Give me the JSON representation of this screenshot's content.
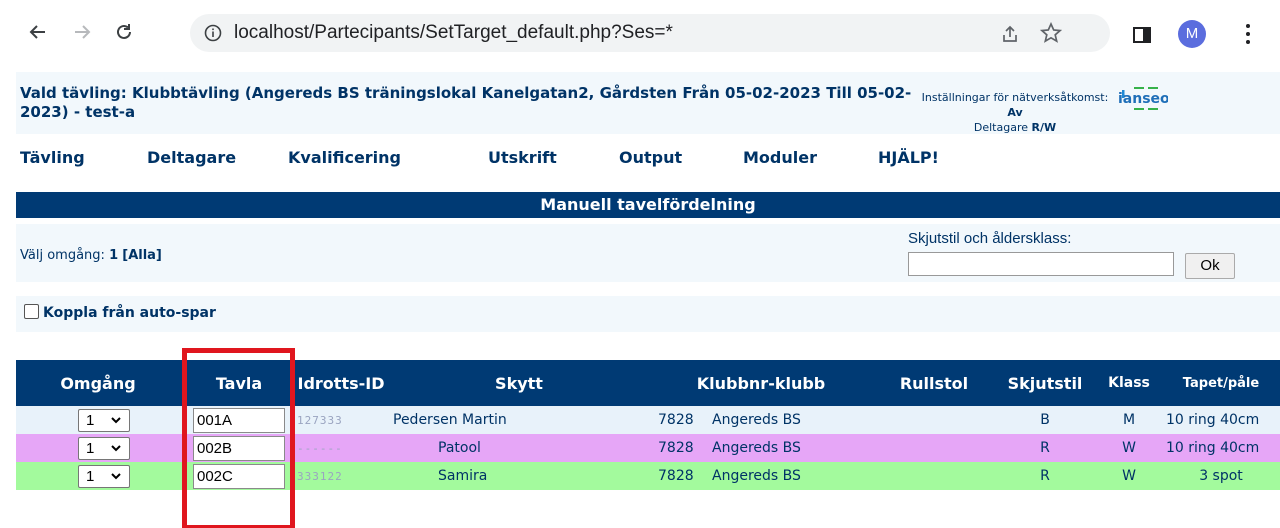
{
  "browser": {
    "url": "localhost/Partecipants/SetTarget_default.php?Ses=*",
    "profile_initial": "M"
  },
  "header": {
    "competition_title": "Vald tävling: Klubbtävling (Angereds BS träningslokal Kanelgatan2, Gårdsten Från 05-02-2023 Till 05-02-2023) - test-a",
    "network_label": "Inställningar för nätverksåtkomst:",
    "network_value": "Av",
    "participants_label": "Deltagare",
    "participants_value": "R/W",
    "logo_text": "ianseo"
  },
  "menu": {
    "items": [
      "Tävling",
      "Deltagare",
      "Kvalificering",
      "Utskrift",
      "Output",
      "Moduler",
      "HJÄLP!"
    ]
  },
  "section_title": "Manuell tavelfördelning",
  "filters": {
    "round_label": "Välj omgång:",
    "round_current": "1",
    "round_all": "[Alla]",
    "style_label": "Skjutstil och åldersklass:",
    "style_input_value": "",
    "ok_label": "Ok"
  },
  "autosave": {
    "label": "Koppla från auto-spar",
    "checked": false
  },
  "table": {
    "columns": {
      "round": "Omgång",
      "target": "Tavla",
      "athlete_id": "Idrotts-ID",
      "archer": "Skytt",
      "club": "Klubbnr-klubb",
      "wheelchair": "Rullstol",
      "style": "Skjutstil",
      "class": "Klass",
      "face": "Tapet/påle"
    },
    "rows": [
      {
        "round": "1",
        "target": "001A",
        "athlete_id": "127333",
        "archer": "Pedersen Martin",
        "club_no": "7828",
        "club": "Angereds BS",
        "wheelchair": "",
        "style": "B",
        "class": "M",
        "face": "10 ring 40cm",
        "bg": "#e8f2fa"
      },
      {
        "round": "1",
        "target": "002B",
        "athlete_id": "------",
        "archer": "Patool",
        "club_no": "7828",
        "club": "Angereds BS",
        "wheelchair": "",
        "style": "R",
        "class": "W",
        "face": "10 ring 40cm",
        "bg": "#e6a6f7"
      },
      {
        "round": "1",
        "target": "002C",
        "athlete_id": "333122",
        "archer": "Samira",
        "club_no": "7828",
        "club": "Angereds BS",
        "wheelchair": "",
        "style": "R",
        "class": "W",
        "face": "3 spot",
        "bg": "#a3fa9d"
      }
    ]
  },
  "colors": {
    "header_blue": "#003a74",
    "text_navy": "#003366",
    "panel_bg": "#f2f8fc",
    "highlight_red": "#e0161e"
  }
}
